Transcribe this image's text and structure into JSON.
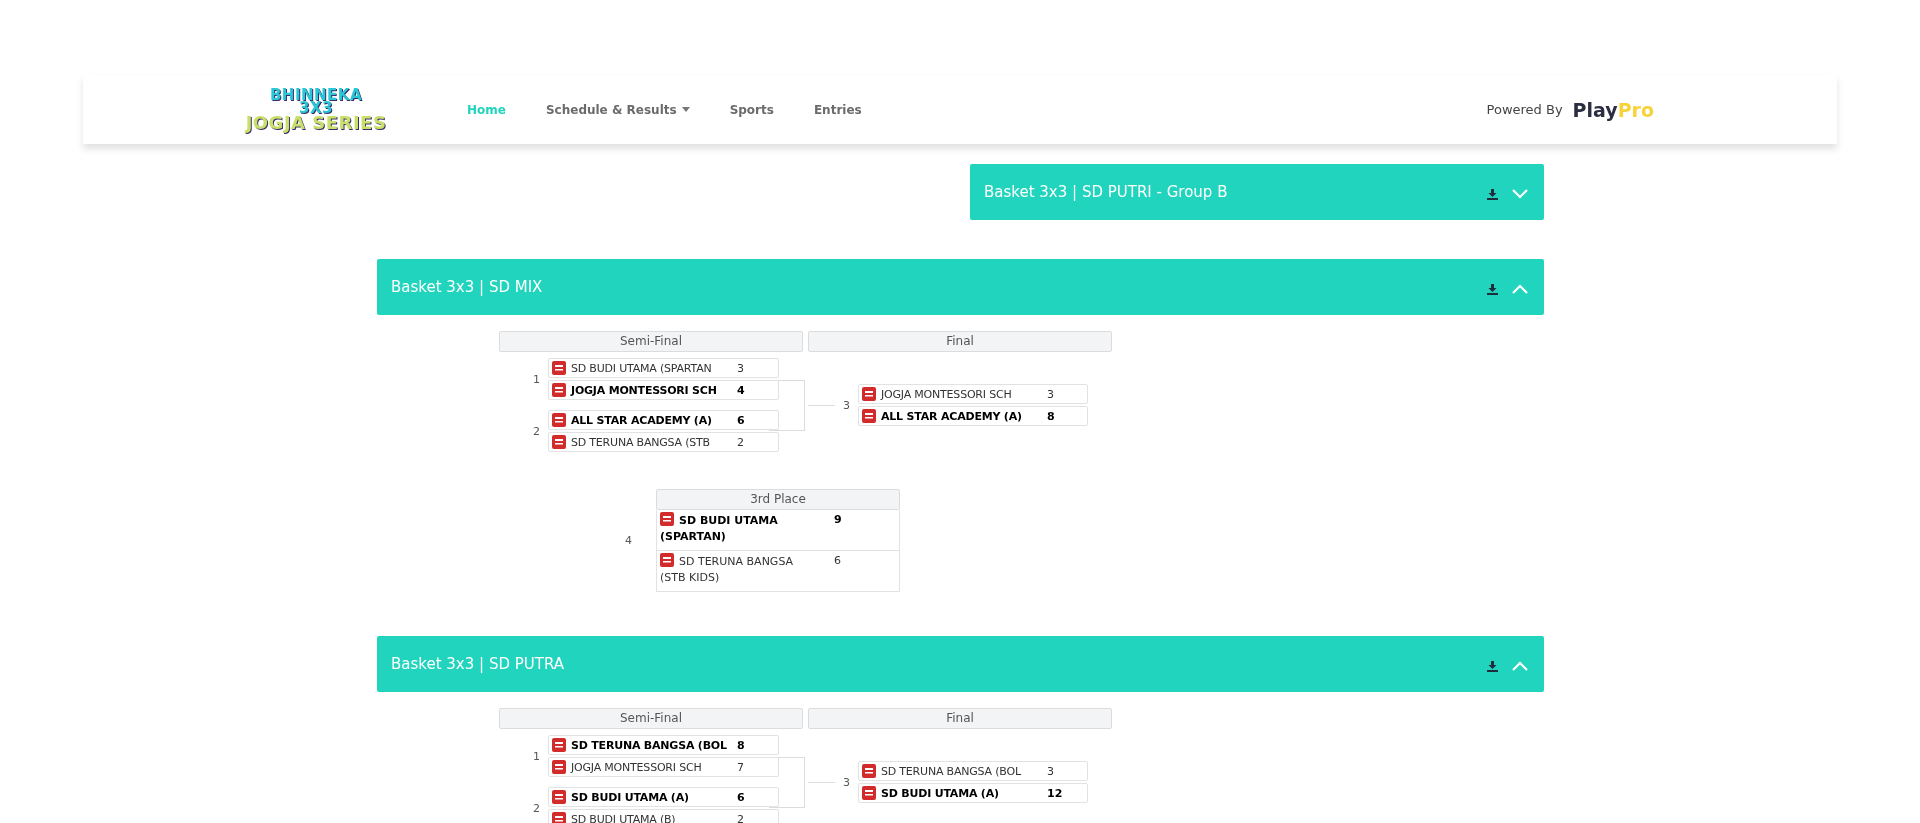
{
  "nav": {
    "logo_lines": [
      "BHINNEKA",
      "3X3",
      "JOGJA SERIES"
    ],
    "items": [
      {
        "label": "Home",
        "selected": true,
        "dropdown": false
      },
      {
        "label": "Schedule & Results",
        "selected": false,
        "dropdown": true
      },
      {
        "label": "Sports",
        "selected": false,
        "dropdown": false
      },
      {
        "label": "Entries",
        "selected": false,
        "dropdown": false
      }
    ],
    "powered_by": "Powered By",
    "brand": [
      "Play",
      "Pro"
    ]
  },
  "sections": [
    {
      "title": "Basket 3x3 | SD PUTRI - Group B",
      "expanded": false
    },
    {
      "title": "Basket 3x3 | SD MIX",
      "expanded": true,
      "rounds": [
        "Semi-Final",
        "Final"
      ],
      "semis": [
        {
          "number": "1",
          "teams": [
            {
              "name": "SD BUDI UTAMA (SPARTAN",
              "score": "3",
              "winner": false
            },
            {
              "name": "JOGJA MONTESSORI SCH",
              "score": "4",
              "winner": true
            }
          ]
        },
        {
          "number": "2",
          "teams": [
            {
              "name": "ALL STAR ACADEMY (A)",
              "score": "6",
              "winner": true
            },
            {
              "name": "SD TERUNA BANGSA (STB",
              "score": "2",
              "winner": false
            }
          ]
        }
      ],
      "final": {
        "number": "3",
        "teams": [
          {
            "name": "JOGJA MONTESSORI SCH",
            "score": "3",
            "winner": false
          },
          {
            "name": "ALL STAR ACADEMY (A)",
            "score": "8",
            "winner": true
          }
        ]
      },
      "third": {
        "label": "3rd Place",
        "number": "4",
        "teams": [
          {
            "name": "SD BUDI UTAMA (SPARTAN)",
            "score": "9",
            "winner": true
          },
          {
            "name": "SD TERUNA BANGSA (STB KIDS)",
            "score": "6",
            "winner": false
          }
        ]
      }
    },
    {
      "title": "Basket 3x3 | SD PUTRA",
      "expanded": true,
      "rounds": [
        "Semi-Final",
        "Final"
      ],
      "semis": [
        {
          "number": "1",
          "teams": [
            {
              "name": "SD TERUNA BANGSA (BOL",
              "score": "8",
              "winner": true
            },
            {
              "name": "JOGJA MONTESSORI SCH",
              "score": "7",
              "winner": false
            }
          ]
        },
        {
          "number": "2",
          "teams": [
            {
              "name": "SD BUDI UTAMA (A)",
              "score": "6",
              "winner": true
            },
            {
              "name": "SD BUDI UTAMA (B)",
              "score": "2",
              "winner": false
            }
          ]
        }
      ],
      "final": {
        "number": "3",
        "teams": [
          {
            "name": "SD TERUNA BANGSA (BOL",
            "score": "3",
            "winner": false
          },
          {
            "name": "SD BUDI UTAMA (A)",
            "score": "12",
            "winner": true
          }
        ]
      }
    }
  ]
}
